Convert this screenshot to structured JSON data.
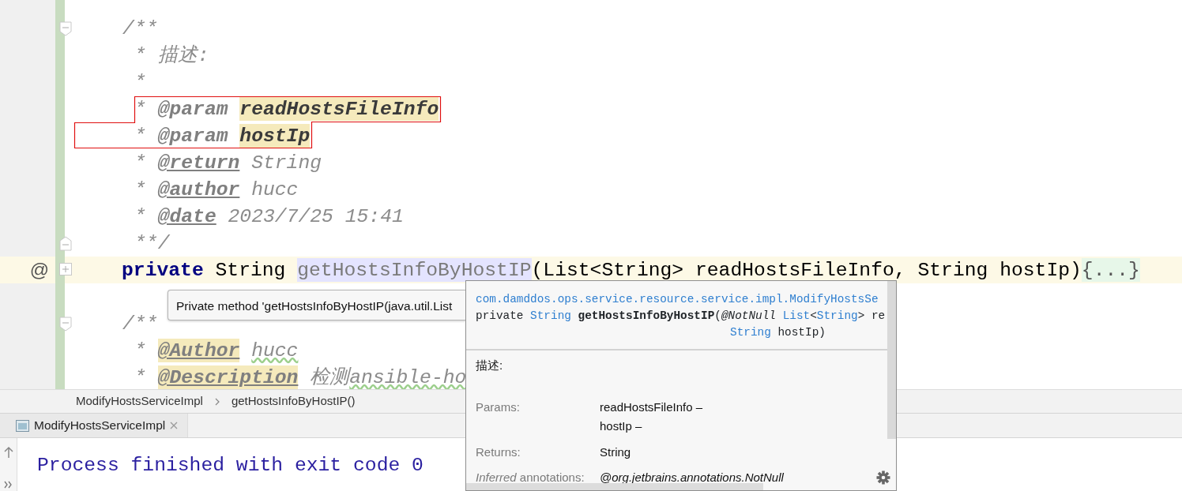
{
  "editor": {
    "lines": [
      {
        "kind": "doc_open",
        "fold_marker": {
          "kind": "start"
        },
        "highlighted": false,
        "segments": [
          {
            "kind": "comment",
            "text": "/**"
          }
        ]
      },
      {
        "kind": "doc_body",
        "highlighted": false,
        "segments": [
          {
            "kind": "comment",
            "text": "*"
          },
          {
            "kind": "comment",
            "text": "描述:"
          }
        ]
      },
      {
        "kind": "doc_body",
        "highlighted": false,
        "segments": [
          {
            "kind": "comment",
            "text": "*"
          }
        ]
      },
      {
        "kind": "doc_body",
        "highlighted": false,
        "segments": [
          {
            "kind": "comment",
            "text": "*"
          },
          {
            "kind": "tag",
            "text": "@param"
          },
          {
            "kind": "param",
            "text": "readHostsFileInfo"
          }
        ]
      },
      {
        "kind": "doc_body",
        "highlighted": false,
        "segments": [
          {
            "kind": "comment",
            "text": "*"
          },
          {
            "kind": "tag",
            "text": "@param"
          },
          {
            "kind": "param",
            "text": "hostIp"
          }
        ]
      },
      {
        "kind": "doc_body",
        "highlighted": false,
        "segments": [
          {
            "kind": "comment",
            "text": "*"
          },
          {
            "kind": "tag_link",
            "text": "@return"
          },
          {
            "kind": "comment",
            "text": "String"
          }
        ]
      },
      {
        "kind": "doc_body",
        "highlighted": false,
        "segments": [
          {
            "kind": "comment",
            "text": "*"
          },
          {
            "kind": "tag_link",
            "text": "@author"
          },
          {
            "kind": "comment",
            "text": "hucc"
          }
        ]
      },
      {
        "kind": "doc_body",
        "highlighted": false,
        "segments": [
          {
            "kind": "comment",
            "text": "*"
          },
          {
            "kind": "tag_link",
            "text": "@date"
          },
          {
            "kind": "comment",
            "text": "2023/7/25 15:41"
          }
        ]
      },
      {
        "kind": "doc_body",
        "fold_marker": {
          "kind": "end"
        },
        "highlighted": false,
        "segments": [
          {
            "kind": "comment",
            "text": "**/"
          }
        ]
      },
      {
        "kind": "code",
        "fold_marker": {
          "kind": "plus"
        },
        "marker": "@",
        "highlighted": true,
        "segments": [
          {
            "kind": "keyword",
            "text": "private"
          },
          {
            "kind": "plain",
            "text": "String"
          },
          {
            "kind": "method",
            "text": "getHostsInfoByHostIP"
          },
          {
            "kind": "plain",
            "text": "(List<String> readHostsFileInfo, String hostIp)",
            "attached": true
          },
          {
            "kind": "folded",
            "text": "{...}",
            "attached": true
          }
        ]
      },
      {
        "kind": "blank",
        "highlighted": false
      },
      {
        "kind": "doc_open",
        "fold_marker": {
          "kind": "start"
        },
        "highlighted": false,
        "segments": [
          {
            "kind": "comment",
            "text": "/**"
          }
        ]
      },
      {
        "kind": "doc_body",
        "highlighted": false,
        "segments": [
          {
            "kind": "comment",
            "text": "*"
          },
          {
            "kind": "tag_mark",
            "text": "@Author"
          },
          {
            "kind": "typo",
            "text": "hucc"
          }
        ]
      },
      {
        "kind": "doc_body",
        "highlighted": false,
        "segments": [
          {
            "kind": "comment",
            "text": "*"
          },
          {
            "kind": "tag_mark",
            "text": "@Description"
          },
          {
            "kind": "comment",
            "text": "检测"
          },
          {
            "kind": "typo",
            "text": "ansible-ho",
            "attached": true
          }
        ]
      }
    ]
  },
  "tooltip": {
    "text": "Private method 'getHostsInfoByHostIP(java.util.List"
  },
  "doc_popup": {
    "signature": [
      [
        {
          "kind": "package",
          "text": "com.damddos.ops.service.resource.service.impl.ModifyHostsSe"
        }
      ],
      [
        {
          "kind": "plain",
          "text": "private "
        },
        {
          "kind": "type",
          "text": "String"
        },
        {
          "kind": "name",
          "text": " getHostsInfoByHostIP"
        },
        {
          "kind": "plain",
          "text": "("
        },
        {
          "kind": "annotation",
          "text": "@NotNull"
        },
        {
          "kind": "type",
          "text": " List"
        },
        {
          "kind": "plain",
          "text": "<"
        },
        {
          "kind": "type",
          "text": "String"
        },
        {
          "kind": "plain",
          "text": "> re"
        }
      ],
      [
        {
          "kind": "indent"
        },
        {
          "kind": "type",
          "text": "String"
        },
        {
          "kind": "plain",
          "text": " hostIp)"
        }
      ]
    ],
    "description": "描述:",
    "sections": [
      {
        "label": "Params:",
        "values": [
          "readHostsFileInfo –",
          "hostIp –"
        ]
      },
      {
        "label": "Returns:",
        "values": [
          "String"
        ]
      },
      {
        "label": "*Inferred* annotations:",
        "values": [
          "@org.jetbrains.annotations.NotNull"
        ],
        "italic_value": true
      }
    ]
  },
  "breadcrumbs": [
    "ModifyHostsServiceImpl",
    "getHostsInfoByHostIP()"
  ],
  "tabs": [
    {
      "label": "ModifyHostsServiceImpl",
      "selected": true
    }
  ],
  "console": {
    "output": "Process finished with exit code 0"
  }
}
